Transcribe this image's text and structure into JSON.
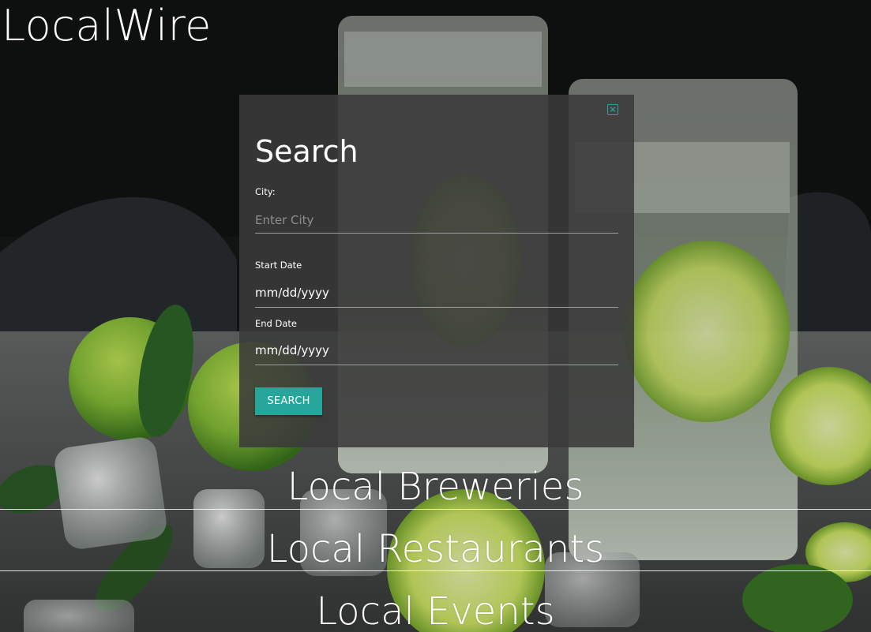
{
  "brand": {
    "title": "LocalWire"
  },
  "search_modal": {
    "title": "Search",
    "close_icon": "close-icon",
    "city": {
      "label": "City:",
      "placeholder": "Enter City",
      "value": ""
    },
    "start_date": {
      "label": "Start Date",
      "value": "mm/dd/yyyy"
    },
    "end_date": {
      "label": "End Date",
      "value": "mm/dd/yyyy"
    },
    "search_button": "SEARCH"
  },
  "categories": [
    {
      "label": "Local Breweries"
    },
    {
      "label": "Local Restaurants"
    },
    {
      "label": "Local Events"
    }
  ],
  "colors": {
    "accent": "#26a69a",
    "modal_bg": "#3a3a3a",
    "text": "#ffffff"
  }
}
